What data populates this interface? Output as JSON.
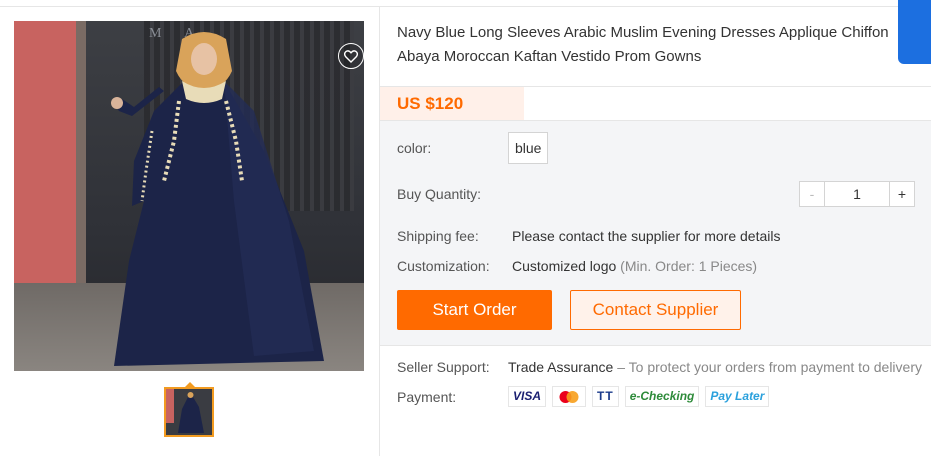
{
  "product": {
    "title": "Navy Blue Long Sleeves Arabic Muslim Evening Dresses Applique Chiffon Abaya Moroccan Kaftan Vestido Prom Gowns",
    "price": "US $120"
  },
  "gallery": {
    "sign_text": "M A"
  },
  "details": {
    "color_label": "color:",
    "color_value": "blue",
    "quantity_label": "Buy Quantity:",
    "quantity_minus": "-",
    "quantity_value": "1",
    "quantity_plus": "+",
    "shipping_label": "Shipping fee:",
    "shipping_value": "Please contact the supplier for more details",
    "customization_label": "Customization:",
    "customization_value": "Customized logo",
    "customization_note": "(Min. Order: 1 Pieces)"
  },
  "actions": {
    "start_order": "Start Order",
    "contact_supplier": "Contact Supplier"
  },
  "support": {
    "label": "Seller Support:",
    "trade_assurance": "Trade Assurance",
    "trade_note": "– To protect your orders from payment to delivery"
  },
  "payment": {
    "label": "Payment:",
    "methods": [
      "VISA",
      "mastercard",
      "TT",
      "e-Checking",
      "Pay Later"
    ]
  },
  "colors": {
    "accent": "#ff6a00",
    "price_bg": "#fff0e9",
    "detail_bg": "#f4f5f7",
    "thumb_border": "#f29b21",
    "side_tab": "#1c6fe0"
  }
}
